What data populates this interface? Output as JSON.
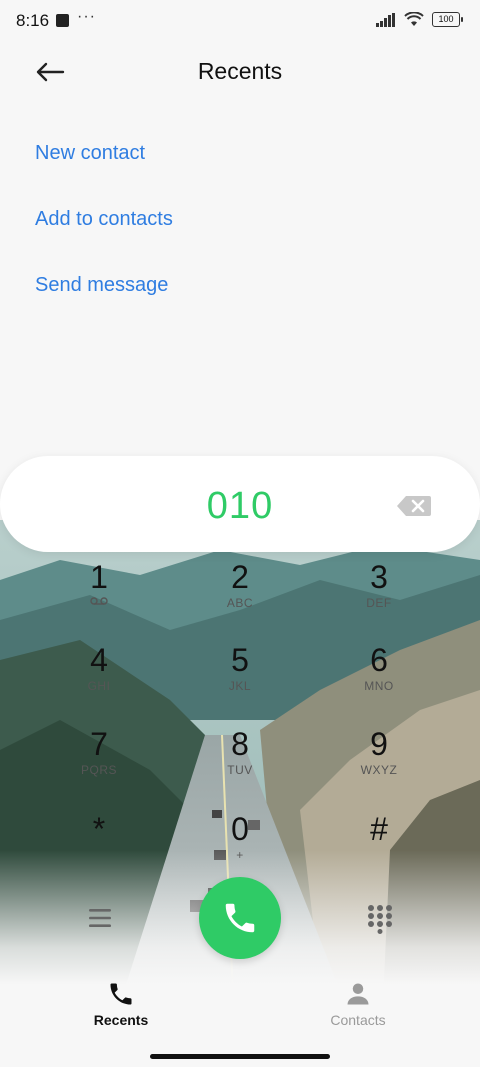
{
  "status": {
    "time": "8:16",
    "dots": "···",
    "battery": "100"
  },
  "header": {
    "title": "Recents"
  },
  "actions": [
    "New contact",
    "Add to contacts",
    "Send message"
  ],
  "dialer": {
    "number": "010",
    "keys": [
      {
        "digit": "1",
        "letters": ""
      },
      {
        "digit": "2",
        "letters": "ABC"
      },
      {
        "digit": "3",
        "letters": "DEF"
      },
      {
        "digit": "4",
        "letters": "GHI"
      },
      {
        "digit": "5",
        "letters": "JKL"
      },
      {
        "digit": "6",
        "letters": "MNO"
      },
      {
        "digit": "7",
        "letters": "PQRS"
      },
      {
        "digit": "8",
        "letters": "TUV"
      },
      {
        "digit": "9",
        "letters": "WXYZ"
      },
      {
        "digit": "*",
        "letters": ""
      },
      {
        "digit": "0",
        "letters": "+"
      },
      {
        "digit": "#",
        "letters": ""
      }
    ]
  },
  "nav": {
    "recents": "Recents",
    "contacts": "Contacts"
  },
  "colors": {
    "accent_blue": "#2f7de1",
    "call_green": "#2fcb66",
    "number_green": "#2fcb66"
  }
}
